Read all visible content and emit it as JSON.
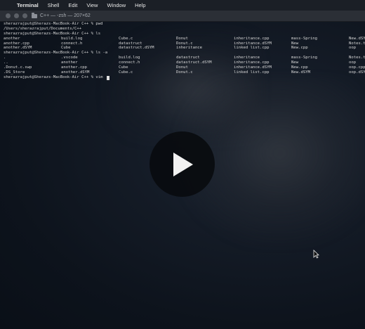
{
  "menubar": {
    "apple": "",
    "items": [
      "Terminal",
      "Shell",
      "Edit",
      "View",
      "Window",
      "Help"
    ]
  },
  "window": {
    "title": "C++ — -zsh — 207×62"
  },
  "terminal": {
    "lines": [
      {
        "cells": [
          "sherazrajput@Sherazs-MacBook-Air C++ % pwd"
        ]
      },
      {
        "cells": [
          "/Users/sherazrajput/Documents/C++"
        ]
      },
      {
        "cells": [
          "sherazrajput@Sherazs-MacBook-Air C++ % ls"
        ]
      },
      {
        "cells": [
          "another",
          "build.log",
          "Cube.c",
          "Donut",
          "inheritance.cpp",
          "mass-Spring",
          "New.dSYM"
        ]
      },
      {
        "cells": [
          "another.cpp",
          "connect.h",
          "datastruct",
          "Donut.c",
          "inheritance.dSYM",
          "New",
          "Notes.txt"
        ]
      },
      {
        "cells": [
          "another.dSYM",
          "Cube",
          "datastruct.dSYM",
          "inheritance",
          "linked list.cpp",
          "New.cpp",
          "oop"
        ]
      },
      {
        "cells": [
          "sherazrajput@Sherazs-MacBook-Air C++ % ls -a"
        ]
      },
      {
        "cells": [
          ".",
          ".vscode",
          "build.log",
          "datastruct",
          "inheritance",
          "mass-Spring",
          "Notes.txt"
        ]
      },
      {
        "cells": [
          "..",
          "another",
          "connect.h",
          "datastruct.dSYM",
          "inheritance.cpp",
          "New",
          "oop"
        ]
      },
      {
        "cells": [
          ".Donut.c.swp",
          "another.cpp",
          "Cube",
          "Donut",
          "inheritance.dSYM",
          "New.cpp",
          "oop.cpp"
        ]
      },
      {
        "cells": [
          ".DS_Store",
          "another.dSYM",
          "Cube.c",
          "Donut.c",
          "linked list.cpp",
          "New.dSYM",
          "oop.dSYM"
        ]
      },
      {
        "cells": [
          "sherazrajput@Sherazs-MacBook-Air C++ % vim "
        ]
      }
    ]
  },
  "icons": {
    "play": "play-icon",
    "pointer": "mouse-pointer-icon"
  }
}
